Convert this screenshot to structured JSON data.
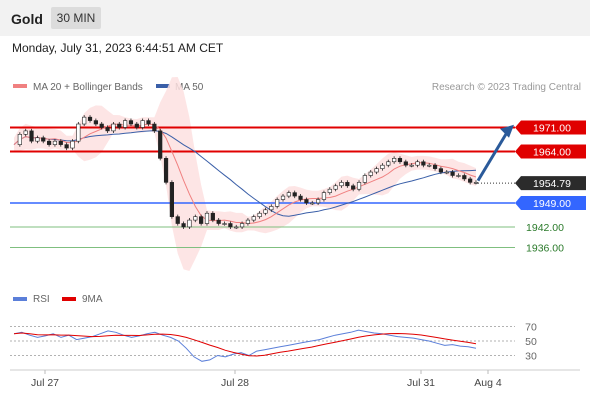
{
  "header": {
    "symbol": "Gold",
    "timeframe": "30 MIN",
    "datetime": "Monday, July 31, 2023 6:44:51 AM CET"
  },
  "legend": {
    "ma20": "MA 20 + Bollinger Bands",
    "ma50": "MA 50",
    "credit": "Research © 2023 Trading Central"
  },
  "rsi_legend": {
    "rsi": "RSI",
    "ma9": "9MA"
  },
  "colors": {
    "resistance": "#e00000",
    "support": "#7fbf7f",
    "pivot": "#3366ff",
    "ma20": "#f08080",
    "ma50": "#3a5fa8",
    "bollinger_fill": "#fde0e0",
    "arrow": "#2a5a9a",
    "rsi_line": "#5b7fd9",
    "rsi_ma": "#e00000"
  },
  "chart_data": {
    "type": "candlestick",
    "x_tick_labels": [
      "Jul 27",
      "Jul 28",
      "Jul 31",
      "Aug 4"
    ],
    "y_range": [
      1928,
      1979
    ],
    "current_price": 1954.79,
    "levels": [
      {
        "value": 1971.0,
        "label": "1971.00",
        "kind": "resistance"
      },
      {
        "value": 1964.0,
        "label": "1964.00",
        "kind": "resistance"
      },
      {
        "value": 1954.79,
        "label": "1954.79",
        "kind": "current"
      },
      {
        "value": 1949.0,
        "label": "1949.00",
        "kind": "pivot"
      },
      {
        "value": 1942.0,
        "label": "1942.00",
        "kind": "support"
      },
      {
        "value": 1936.0,
        "label": "1936.00",
        "kind": "support"
      }
    ],
    "price_path": [
      1966,
      1969,
      1970,
      1967,
      1968,
      1967,
      1966,
      1967,
      1966,
      1965,
      1967,
      1972,
      1974,
      1973,
      1972,
      1971,
      1970,
      1972,
      1971,
      1973,
      1972,
      1971,
      1973,
      1972,
      1970,
      1962,
      1955,
      1945,
      1943,
      1942,
      1944,
      1945,
      1943,
      1946,
      1944,
      1943,
      1943,
      1942,
      1942,
      1943,
      1944,
      1945,
      1946,
      1947,
      1948,
      1950,
      1951,
      1952,
      1951,
      1950,
      1949,
      1949,
      1950,
      1952,
      1953,
      1954,
      1955,
      1954,
      1953,
      1955,
      1957,
      1958,
      1959,
      1960,
      1961,
      1962,
      1961,
      1960,
      1960,
      1961,
      1960,
      1960,
      1959,
      1958,
      1958,
      1957,
      1957,
      1956,
      1955,
      1955
    ],
    "rsi_levels": [
      70,
      50,
      30
    ],
    "rsi_path": [
      60,
      62,
      58,
      55,
      57,
      60,
      55,
      58,
      52,
      54,
      56,
      60,
      64,
      62,
      58,
      55,
      57,
      60,
      62,
      58,
      55,
      50,
      40,
      28,
      22,
      24,
      30,
      28,
      32,
      34,
      30,
      36,
      38,
      40,
      42,
      44,
      46,
      48,
      50,
      52,
      55,
      58,
      60,
      62,
      65,
      63,
      61,
      60,
      58,
      56,
      55,
      54,
      52,
      50,
      47,
      44,
      45,
      43,
      42,
      40
    ]
  }
}
